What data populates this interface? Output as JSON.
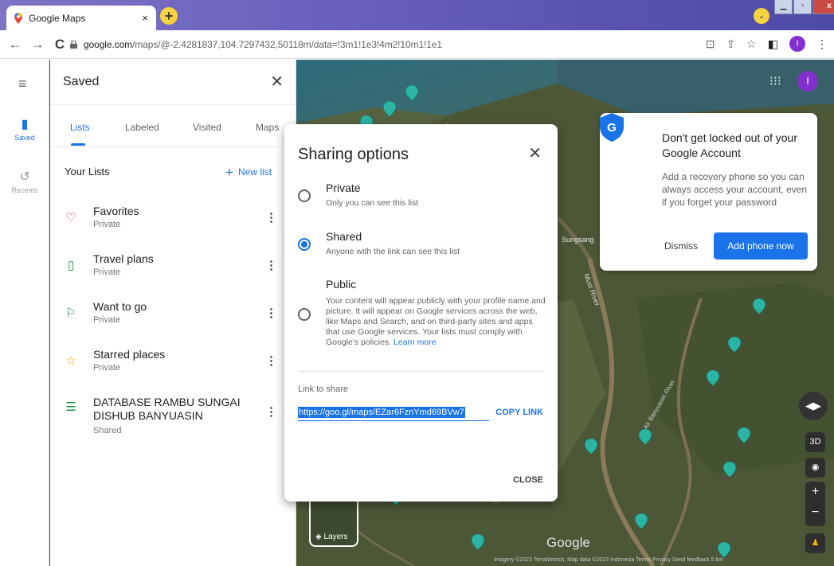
{
  "browser": {
    "tab_title": "Google Maps",
    "tab_close": "×",
    "new_tab": "+",
    "url_host": "google.com",
    "url_path": "/maps/@-2.4281837,104.7297432,50118m/data=!3m1!1e3!4m2!10m1!1e1",
    "profile_initial": "I"
  },
  "rail": {
    "saved_label": "Saved",
    "recents_label": "Recents"
  },
  "panel": {
    "title": "Saved",
    "tabs": [
      "Lists",
      "Labeled",
      "Visited",
      "Maps"
    ],
    "lists_title": "Your Lists",
    "new_list_label": "New list",
    "lists": [
      {
        "name": "Favorites",
        "sub": "Private",
        "icon": "heart-icon",
        "color": "#c2185b"
      },
      {
        "name": "Travel plans",
        "sub": "Private",
        "icon": "suitcase-icon",
        "color": "#1e8e3e"
      },
      {
        "name": "Want to go",
        "sub": "Private",
        "icon": "flag-icon",
        "color": "#1e8e3e"
      },
      {
        "name": "Starred places",
        "sub": "Private",
        "icon": "star-icon",
        "color": "#f29900"
      },
      {
        "name": "DATABASE RAMBU SUNGAI DISHUB BANYUASIN",
        "sub": "Shared",
        "icon": "list-icon",
        "color": "#1e8e3e"
      }
    ]
  },
  "map": {
    "account_initial": "I",
    "labels": [
      "Sungsang",
      "Musi River",
      "Air Banyuasin River"
    ],
    "layers_label": "Layers",
    "google_logo": "Google",
    "attribution": "Imagery ©2023 TerraMetrics, Map data ©2023   Indonesia   Terms   Privacy   Send feedback   5 km",
    "control_3d": "3D"
  },
  "account_card": {
    "title": "Don't get locked out of your Google Account",
    "body": "Add a recovery phone so you can always access your account, even if you forget your password",
    "dismiss": "Dismiss",
    "add": "Add phone now"
  },
  "dialog": {
    "title": "Sharing options",
    "options": [
      {
        "title": "Private",
        "desc": "Only you can see this list",
        "selected": false
      },
      {
        "title": "Shared",
        "desc": "Anyone with the link can see this list",
        "selected": true
      },
      {
        "title": "Public",
        "desc": "Your content will appear publicly with your profile name and picture. It will appear on Google services across the web, like Maps and Search, and on third-party sites and apps that use Google services. Your lists must comply with Google's policies.",
        "learn_more": "Learn more",
        "selected": false
      }
    ],
    "link_label": "Link to share",
    "link_value": "https://goo.gl/maps/EZar6FznYmd69BVw7",
    "copy_link": "COPY LINK",
    "close": "CLOSE"
  },
  "colors": {
    "accent": "#1a73e8",
    "chrome_bar": "#6a60bd",
    "map_ground": "#4a5537",
    "pin": "#2bb3a3"
  }
}
